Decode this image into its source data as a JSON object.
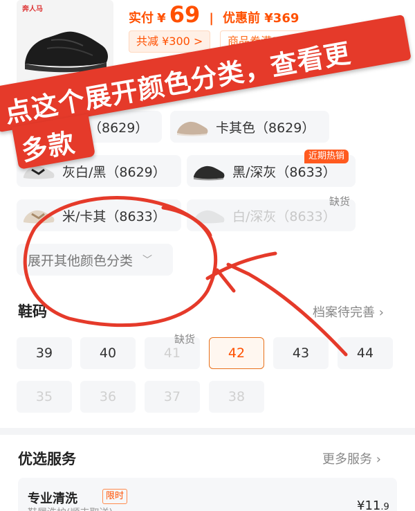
{
  "product": {
    "logo_text": "奔人马",
    "price_label": "实付",
    "currency": "¥",
    "price": "69",
    "separator": "|",
    "pre_price": "优惠前 ¥369",
    "discount_chip": "共减 ¥300 >",
    "coupon_chip": "商品券满369减300"
  },
  "annotation": {
    "line1": "点这个展开颜色分类，查看更",
    "line2": "多款",
    "color": "#e53a2a"
  },
  "colors": {
    "items": [
      {
        "label": "黑色（8629）",
        "state": "available"
      },
      {
        "label": "卡其色（8629）",
        "state": "available"
      },
      {
        "label": "灰白/黑（8629）",
        "state": "available"
      },
      {
        "label": "黑/深灰（8633）",
        "state": "available"
      },
      {
        "label": "米/卡其（8633）",
        "state": "available"
      },
      {
        "label": "白/深灰（8633）",
        "state": "disabled"
      }
    ],
    "hot_tag": "近期热销",
    "out_of_stock_tag": "缺货",
    "expand_label": "展开其他颜色分类"
  },
  "sizes": {
    "title": "鞋码",
    "archive_link": "档案待完善",
    "out_of_stock_tag": "缺货",
    "items": [
      {
        "label": "39",
        "state": "available"
      },
      {
        "label": "40",
        "state": "available"
      },
      {
        "label": "41",
        "state": "disabled"
      },
      {
        "label": "42",
        "state": "selected"
      },
      {
        "label": "43",
        "state": "available"
      },
      {
        "label": "44",
        "state": "available"
      },
      {
        "label": "35",
        "state": "disabled"
      },
      {
        "label": "36",
        "state": "disabled"
      },
      {
        "label": "37",
        "state": "disabled"
      },
      {
        "label": "38",
        "state": "disabled"
      }
    ]
  },
  "services": {
    "title": "优选服务",
    "more_link": "更多服务",
    "card": {
      "name": "专业清洗",
      "badge": "限时",
      "subtitle": "鞋履洗护(顺丰取送)",
      "price_main": "¥11",
      "price_decimal": ".9"
    }
  },
  "accent_color": "#ff5000"
}
